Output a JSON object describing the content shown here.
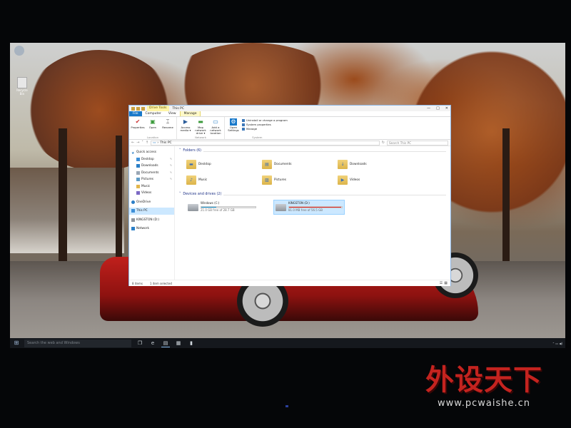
{
  "colors": {
    "accent": "#1979ca",
    "selection": "#cce8ff",
    "progress_normal": "#26a0da",
    "progress_full": "#da2626",
    "watermark": "#c4231f"
  },
  "desktop": {
    "icon_label": "Recycle Bin"
  },
  "window": {
    "context_tab": "Drive Tools",
    "title": "This PC",
    "controls": [
      "—",
      "□",
      "✕"
    ],
    "ribbon_tabs": [
      "File",
      "Computer",
      "View",
      "Manage"
    ],
    "ribbon": {
      "location": {
        "name": "Location",
        "buttons": [
          "Properties",
          "Open",
          "Rename"
        ]
      },
      "network": {
        "name": "Network",
        "buttons": [
          "Access media ▾",
          "Map network drive ▾",
          "Add a network location"
        ]
      },
      "system": {
        "name": "System",
        "open_settings": "Open Settings",
        "small": [
          "Uninstall or change a program",
          "System properties",
          "Manage"
        ]
      }
    },
    "address": {
      "path": "This PC",
      "search_placeholder": "Search This PC"
    },
    "nav": {
      "quick_access": "Quick access",
      "quick_items": [
        "Desktop",
        "Downloads",
        "Documents",
        "Pictures",
        "Music",
        "Videos"
      ],
      "onedrive": "OneDrive",
      "this_pc": "This PC",
      "kingston": "KINGSTON (D:)",
      "network": "Network"
    },
    "folders_header": "Folders (6)",
    "folders": [
      "Desktop",
      "Documents",
      "Downloads",
      "Music",
      "Pictures",
      "Videos"
    ],
    "drives_header": "Devices and drives (2)",
    "drives": [
      {
        "name": "Windows (C:)",
        "free": "21.0 GB free of 28.7 GB",
        "used_fraction": 0.27
      },
      {
        "name": "KINGSTON (D:)",
        "free": "81.0 MB free of 56.5 GB",
        "used_fraction": 0.99
      }
    ],
    "status": {
      "items": "8 items",
      "selected": "1 item selected"
    }
  },
  "taskbar": {
    "search_placeholder": "Search the web and Windows"
  },
  "watermark": {
    "main": "外设天下",
    "sub": "www.pcwaishe.cn"
  }
}
